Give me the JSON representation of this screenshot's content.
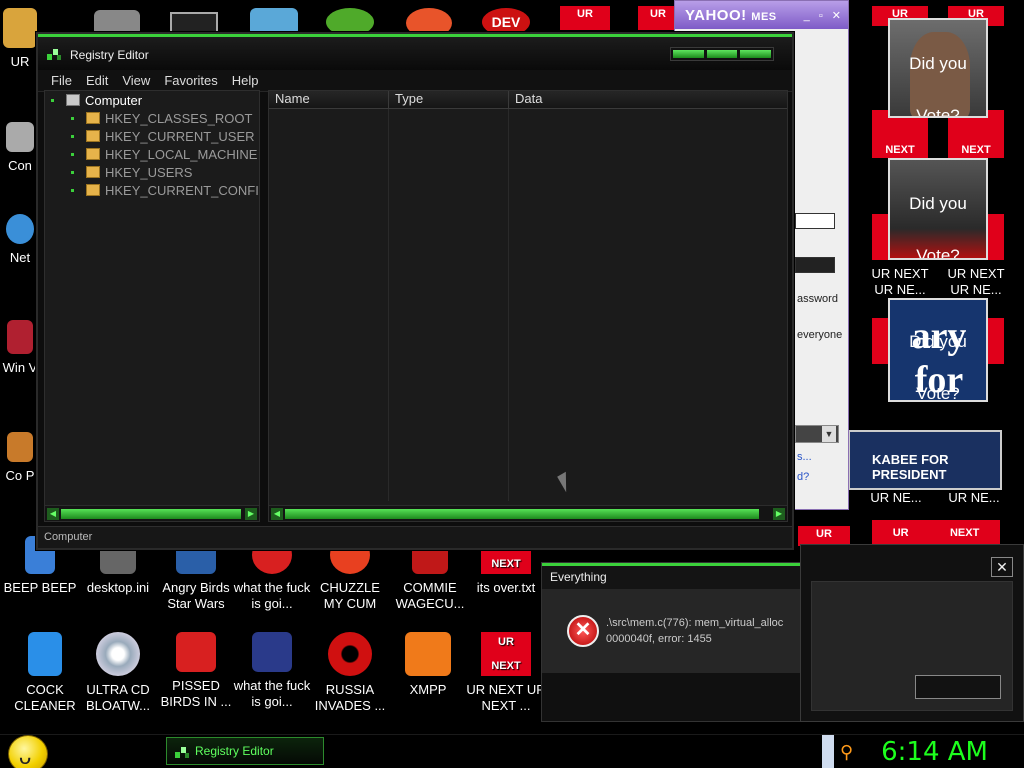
{
  "desktop": {
    "icons_row1": [
      "BEEP BEEP",
      "desktop.ini",
      "Angry Birds Star Wars",
      "what the fuck is goi...",
      "CHUZZLE MY CUM",
      "COMMIE WAGECU...",
      "its over.txt"
    ],
    "icons_row2": [
      "COCK CLEANER",
      "ULTRA CD BLOATW...",
      "PISSED BIRDS IN ...",
      "what the fuck is goi...",
      "RUSSIA INVADES ...",
      "XMPP",
      "UR NEXT UR NEXT ..."
    ],
    "left_partial": [
      "UR",
      "Con",
      "Net",
      "Win V",
      "Co P"
    ],
    "ur_tile": {
      "top": "UR",
      "bottom": "NEXT"
    },
    "right_labels": [
      "UR NEXT",
      "UR NE...",
      "UR NEXT",
      "UR NE...",
      "UR NE...",
      "UR NE..."
    ],
    "posters": [
      "Did you Vote?",
      "Did you Vote?",
      "Did you Vote?"
    ],
    "poster_logo": "ary for",
    "huckabee_banner": "KABEE FOR PRESIDENT",
    "extra_tile_labels": [
      "UR",
      "UR",
      "UR",
      "UR",
      "UR",
      "UR",
      "NEXT",
      "NEXT",
      "NEXT",
      "NEXT"
    ]
  },
  "regedit": {
    "title": "Registry Editor",
    "menu": [
      "File",
      "Edit",
      "View",
      "Favorites",
      "Help"
    ],
    "tree_root": "Computer",
    "tree_items": [
      "HKEY_CLASSES_ROOT",
      "HKEY_CURRENT_USER",
      "HKEY_LOCAL_MACHINE",
      "HKEY_USERS",
      "HKEY_CURRENT_CONFI"
    ],
    "columns": [
      "Name",
      "Type",
      "Data"
    ],
    "status": "Computer"
  },
  "yahoo": {
    "title": "YAHOO!",
    "title_suffix": "MES",
    "password_label": "assword",
    "everyone_label": "everyone",
    "link1": "s...",
    "link2": "d?"
  },
  "everything_dialog": {
    "title": "Everything",
    "message_line1": ".\\src\\mem.c(776): mem_virtual_alloc",
    "message_line2": "0000040f, error: 1455"
  },
  "taskbar": {
    "task_label": "Registry Editor",
    "clock": "6:14 AM"
  },
  "colors": {
    "accent_green": "#3bd13b",
    "clock_green": "#1dff1d",
    "ur_red": "#e0001a",
    "yahoo_purple": "#7e5bc7"
  }
}
